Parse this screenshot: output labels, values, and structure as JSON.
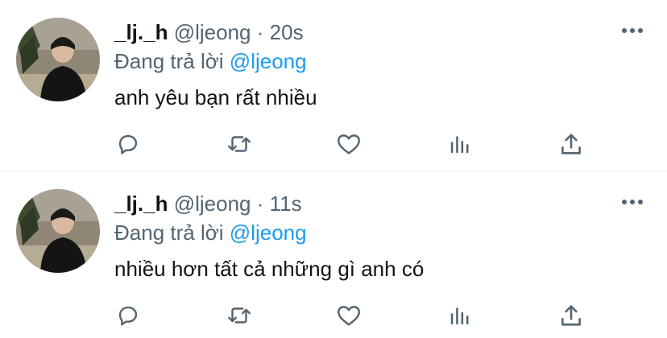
{
  "tweets": [
    {
      "name": "_lj._h",
      "handle": "@ljeong",
      "separator": "·",
      "time": "20s",
      "replying_prefix": "Đang trả lời",
      "replying_to": "@ljeong",
      "text": "anh yêu bạn rất nhiều"
    },
    {
      "name": "_lj._h",
      "handle": "@ljeong",
      "separator": "·",
      "time": "11s",
      "replying_prefix": "Đang trả lời",
      "replying_to": "@ljeong",
      "text": "nhiều hơn tất cả những gì anh có"
    }
  ],
  "icons": {
    "reply": "reply-icon",
    "retweet": "retweet-icon",
    "like": "heart-icon",
    "analytics": "analytics-icon",
    "share": "share-icon",
    "more": "more-icon"
  },
  "colors": {
    "text": "#0f1419",
    "secondary": "#536471",
    "accent": "#1d9bf0",
    "divider": "#e6ecf0"
  }
}
